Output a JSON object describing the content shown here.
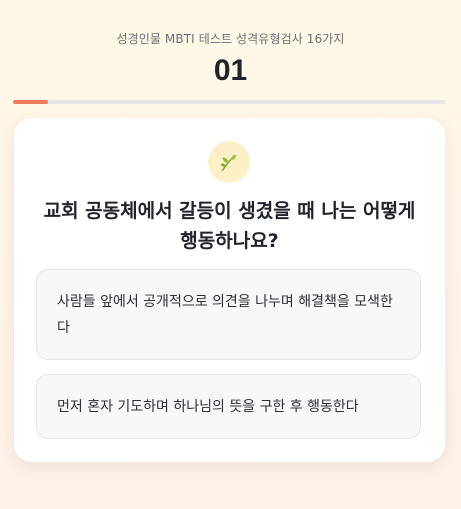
{
  "header": {
    "subtitle": "성경인물 MBTI 테스트 성격유형검사 16가지",
    "question_number": "01"
  },
  "progress": {
    "fraction": 0.08
  },
  "colors": {
    "accent": "#f07a5c",
    "badge_bg": "#fdf0c6",
    "leaf": "#7aa62b"
  },
  "card": {
    "icon": "leaf-icon",
    "question": "교회 공동체에서 갈등이 생겼을 때 나는 어떻게 행동하나요?",
    "options": [
      {
        "label": "사람들 앞에서 공개적으로 의견을 나누며 해결책을 모색한다"
      },
      {
        "label": "먼저 혼자 기도하며 하나님의 뜻을 구한 후 행동한다"
      }
    ]
  }
}
